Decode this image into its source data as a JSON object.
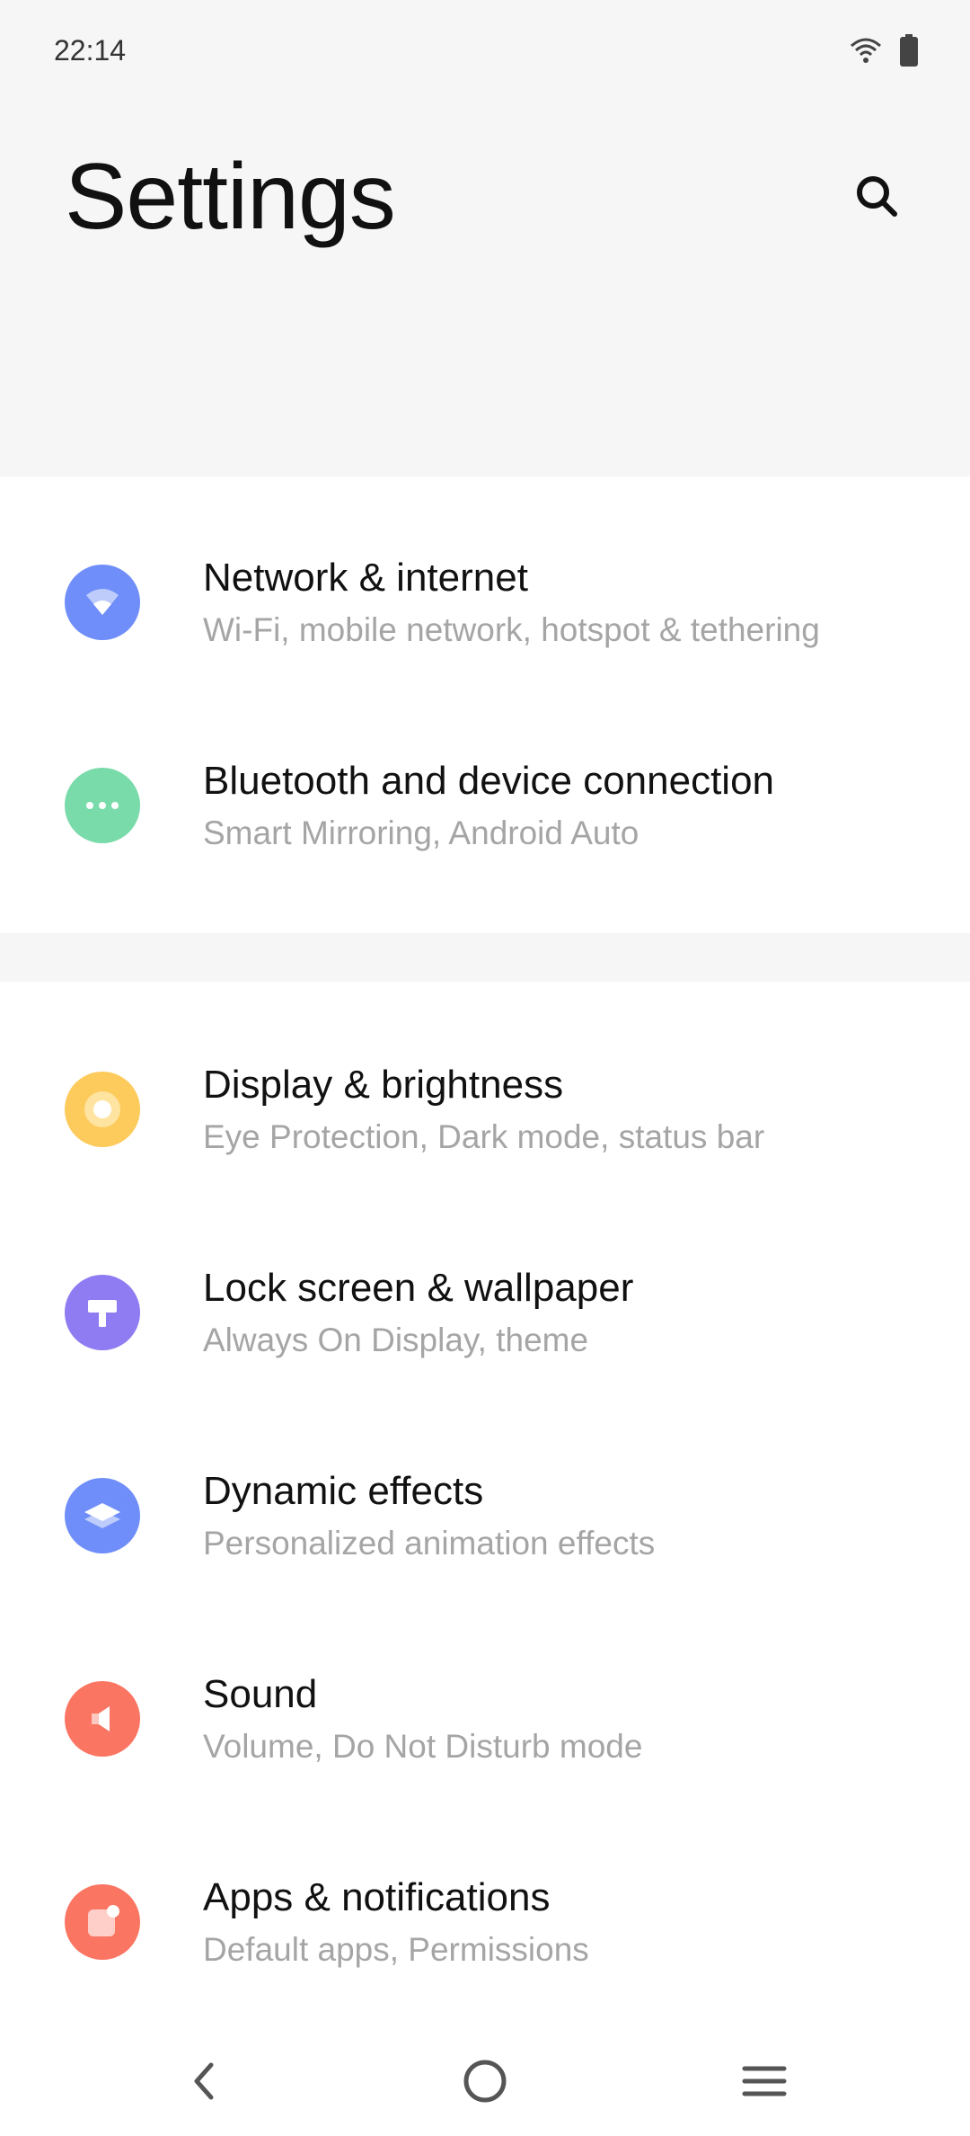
{
  "status_bar": {
    "time": "22:14",
    "icons": [
      "wifi-icon",
      "battery-icon"
    ]
  },
  "header": {
    "title": "Settings",
    "search_icon": "search-icon"
  },
  "groups": [
    {
      "items": [
        {
          "title": "Network & internet",
          "subtitle": "Wi-Fi, mobile network, hotspot & tethering",
          "icon": "wifi-icon",
          "color": "#6f8ef9"
        },
        {
          "title": "Bluetooth and device connection",
          "subtitle": "Smart Mirroring, Android Auto",
          "icon": "bluetooth-dots-icon",
          "color": "#79dbaa"
        }
      ]
    },
    {
      "items": [
        {
          "title": "Display & brightness",
          "subtitle": "Eye Protection, Dark mode, status bar",
          "icon": "brightness-icon",
          "color": "#fdcb5c"
        },
        {
          "title": "Lock screen & wallpaper",
          "subtitle": "Always On Display, theme",
          "icon": "paint-roller-icon",
          "color": "#8f7bf2"
        },
        {
          "title": "Dynamic effects",
          "subtitle": "Personalized animation effects",
          "icon": "layers-icon",
          "color": "#6f8ef9"
        },
        {
          "title": "Sound",
          "subtitle": "Volume, Do Not Disturb mode",
          "icon": "speaker-icon",
          "color": "#fb7563"
        },
        {
          "title": "Apps & notifications",
          "subtitle": "Default apps, Permissions",
          "icon": "app-notification-icon",
          "color": "#fb7563"
        }
      ]
    }
  ],
  "nav_bar": {
    "buttons": [
      "back-icon",
      "home-icon",
      "menu-icon"
    ]
  }
}
